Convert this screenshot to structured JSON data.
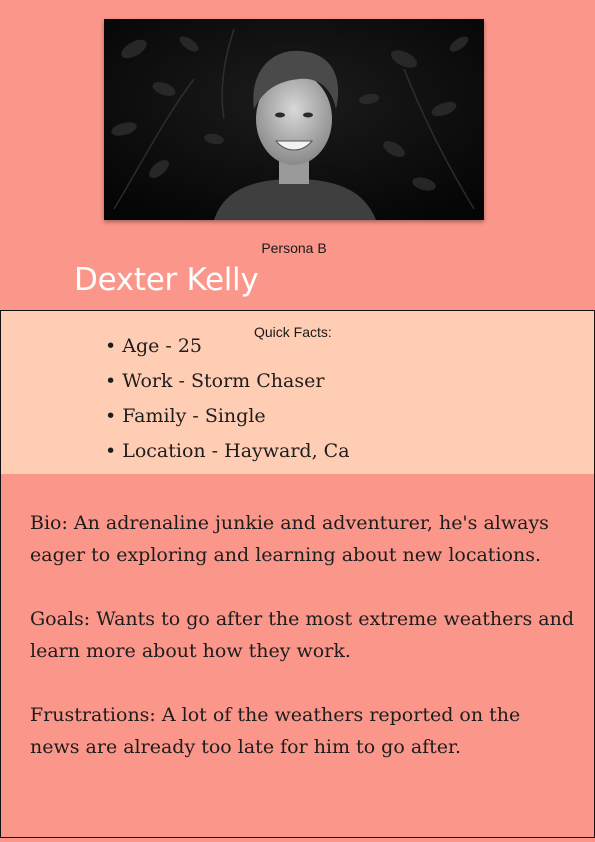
{
  "photo": {
    "alt": "",
    "icon": "portrait-photo"
  },
  "persona": {
    "label": "Persona B",
    "name": "Dexter Kelly"
  },
  "quick_facts": {
    "title": "Quick Facts:",
    "items": [
      "Age - 25",
      "Work - Storm Chaser",
      "Family -  Single",
      "Location - Hayward, Ca"
    ]
  },
  "details": {
    "bio": "Bio: An adrenaline junkie and adventurer, he's always eager to exploring and learning about new locations.",
    "goals": "Goals: Wants to go after the most extreme weathers and learn more about how they work.",
    "frustrations": "Frustrations: A lot of the weathers reported on the news are already too late for him to go after."
  },
  "colors": {
    "background": "#fb968a",
    "facts_background": "#ffcdb3",
    "name_text": "#ffffff",
    "border": "#111111"
  }
}
